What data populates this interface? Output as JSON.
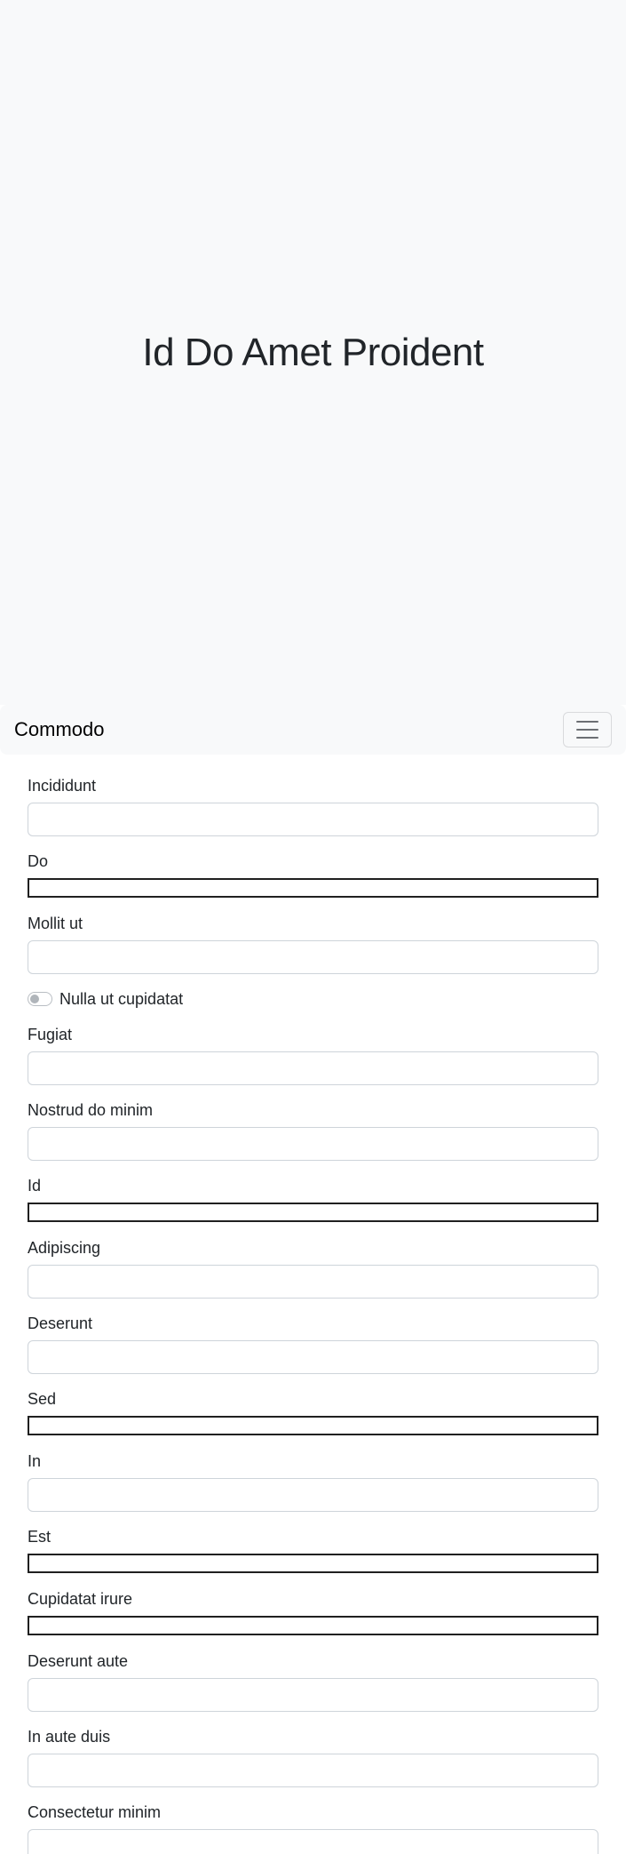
{
  "hero": {
    "title": "Id Do Amet Proident"
  },
  "navbar": {
    "brand": "Commodo",
    "toggle_icon": "hamburger-menu-icon"
  },
  "form": {
    "fields": [
      {
        "label": "Incididunt",
        "type": "text"
      },
      {
        "label": "Do",
        "type": "plain"
      },
      {
        "label": "Mollit ut",
        "type": "text"
      },
      {
        "label": "Nulla ut cupidatat",
        "type": "switch",
        "checked": false
      },
      {
        "label": "Fugiat",
        "type": "text"
      },
      {
        "label": "Nostrud do minim",
        "type": "text"
      },
      {
        "label": "Id",
        "type": "plain"
      },
      {
        "label": "Adipiscing",
        "type": "text"
      },
      {
        "label": "Deserunt",
        "type": "text"
      },
      {
        "label": "Sed",
        "type": "plain"
      },
      {
        "label": "In",
        "type": "text"
      },
      {
        "label": "Est",
        "type": "plain"
      },
      {
        "label": "Cupidatat irure",
        "type": "plain"
      },
      {
        "label": "Deserunt aute",
        "type": "text"
      },
      {
        "label": "In aute duis",
        "type": "text"
      },
      {
        "label": "Consectetur minim",
        "type": "text"
      }
    ]
  }
}
